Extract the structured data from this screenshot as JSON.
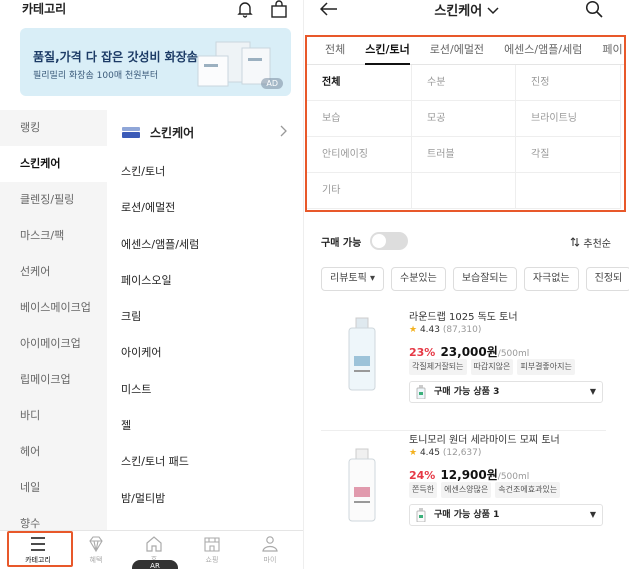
{
  "left": {
    "header": {
      "title": "카테고리",
      "bell_icon": "bell-icon",
      "bag_icon": "shopping-bag-icon"
    },
    "ad": {
      "main": "품질,가격 다 잡은 갓성비 화장솜",
      "sub": "필리밀리 화장솜 100매 천원부터",
      "badge": "AD"
    },
    "categories": [
      "랭킹",
      "스킨케어",
      "클렌징/필링",
      "마스크/팩",
      "선케어",
      "베이스메이크업",
      "아이메이크업",
      "립메이크업",
      "바디",
      "헤어",
      "네일",
      "향수"
    ],
    "active_category": "스킨케어",
    "subcategory_header": "스킨케어",
    "subcategories": [
      "스킨/토너",
      "로션/에멀전",
      "에센스/앰플/세럼",
      "페이스오일",
      "크림",
      "아이케어",
      "미스트",
      "젤",
      "스킨/토너 패드",
      "밤/멀티밤"
    ],
    "nav": [
      {
        "label": "카테고리",
        "icon": "menu-icon"
      },
      {
        "label": "혜택",
        "icon": "diamond-icon"
      },
      {
        "label": "홈",
        "icon": "home-icon"
      },
      {
        "label": "쇼핑",
        "icon": "store-icon"
      },
      {
        "label": "마이",
        "icon": "person-icon"
      }
    ],
    "float_pill": "AR"
  },
  "right": {
    "header": {
      "title": "스킨케어",
      "back_icon": "back-arrow-icon",
      "search_icon": "search-icon"
    },
    "tabs": [
      "전체",
      "스킨/토너",
      "로션/에멀전",
      "에센스/앰플/세럼",
      "페이"
    ],
    "active_tab": "스킨/토너",
    "subfilters": [
      "전체",
      "수분",
      "진정",
      "보습",
      "모공",
      "브라이트닝",
      "안티에이징",
      "트러블",
      "각질",
      "기타",
      "",
      ""
    ],
    "active_subfilter": "전체",
    "buy_toggle_label": "구매 가능",
    "sort_label": "추천순",
    "chips": [
      "리뷰토픽 ▾",
      "수분있는",
      "보습잘되는",
      "자극없는",
      "진정되"
    ],
    "products": [
      {
        "name": "라운드랩 1025 독도 토너",
        "rating": "4.43",
        "reviews": "(87,310)",
        "discount": "23%",
        "price": "23,000원",
        "volume": "/500ml",
        "tags": [
          "각질제거잘되는",
          "따갑지않은",
          "피부결좋아지는"
        ],
        "buy_label": "구매 가능 상품 3"
      },
      {
        "name": "토니모리 원더 세라마이드 모찌 토너",
        "rating": "4.45",
        "reviews": "(12,637)",
        "discount": "24%",
        "price": "12,900원",
        "volume": "/500ml",
        "tags": [
          "쫀득한",
          "에센스양많은",
          "속건조에효과있는"
        ],
        "buy_label": "구매 가능 상품 1"
      }
    ],
    "colors": {
      "accent": "#e8582a",
      "discount": "#e63946",
      "star": "#f3b11e",
      "ad_bg": "#d9eef7"
    }
  }
}
